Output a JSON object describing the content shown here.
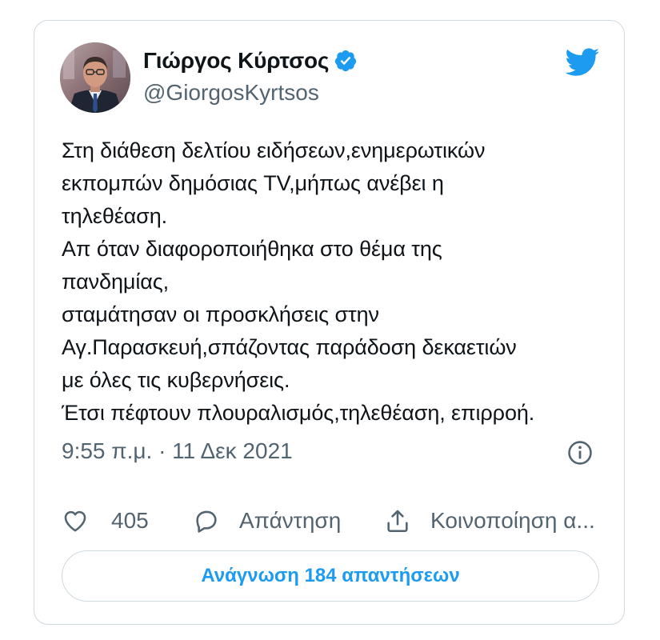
{
  "author": {
    "display_name": "Γιώργος Κύρτσος",
    "handle": "@GiorgosKyrtsos",
    "verified": true
  },
  "tweet": {
    "text": "Στη διάθεση δελτίου ειδήσεων,ενημερωτικών\nεκπομπών δημόσιας TV,μήπως ανέβει η\nτηλεθέαση.\nΑπ όταν διαφοροποιήθηκα στο θέμα της\nπανδημίας,\nσταμάτησαν οι προσκλήσεις στην\nΑγ.Παρασκευή,σπάζοντας παράδοση δεκαετιών\nμε όλες τις κυβερνήσεις.\nΈτσι πέφτουν πλουραλισμός,τηλεθέαση, επιρροή.",
    "timestamp": "9:55 π.μ. · 11 Δεκ 2021"
  },
  "actions": {
    "like_count": "405",
    "reply_label": "Απάντηση",
    "share_label": "Κοινοποίηση α..."
  },
  "replies_button": {
    "label": "Ανάγνωση 184 απαντήσεων"
  },
  "icons": {
    "brand": "twitter-bird-icon",
    "verified": "verified-badge-icon",
    "info": "info-icon",
    "like": "heart-icon",
    "reply": "speech-bubble-icon",
    "share": "share-upload-icon"
  },
  "colors": {
    "twitter_blue": "#1d9bf0",
    "text_primary": "#0f1419",
    "text_secondary": "#536471",
    "border": "#cfd9de"
  }
}
